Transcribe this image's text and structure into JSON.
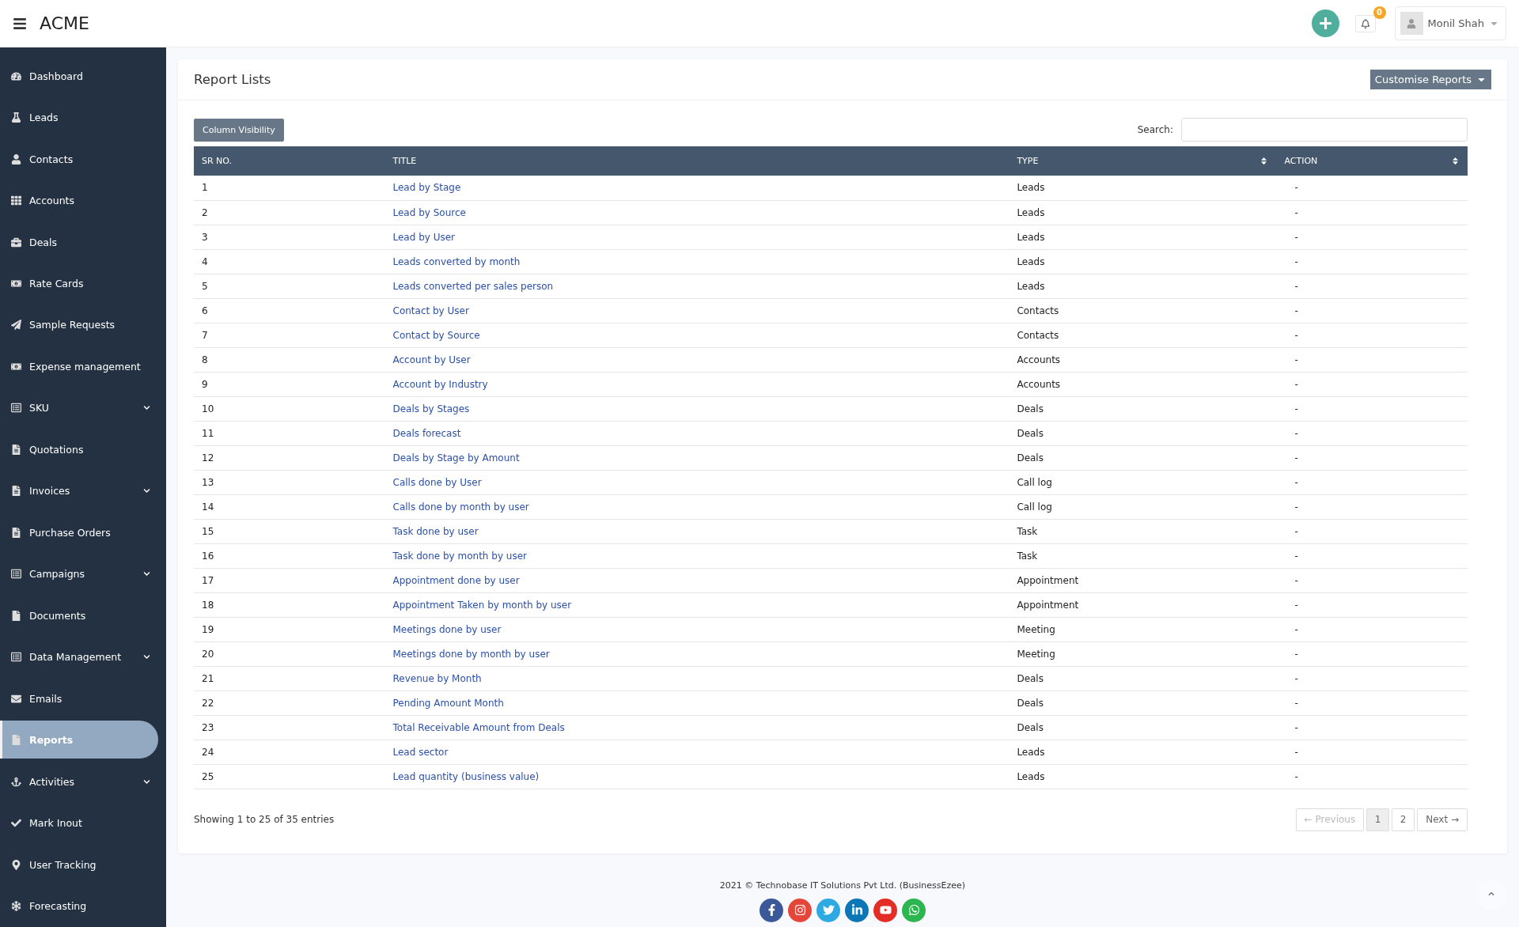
{
  "topbar": {
    "brand": "ACME",
    "notifications": {
      "count": "0"
    },
    "user": {
      "name": "Monil Shah"
    }
  },
  "sidebar": {
    "items": [
      {
        "label": "Dashboard",
        "selected": false,
        "has_submenu": false
      },
      {
        "label": "Leads",
        "selected": false,
        "has_submenu": false
      },
      {
        "label": "Contacts",
        "selected": false,
        "has_submenu": false
      },
      {
        "label": "Accounts",
        "selected": false,
        "has_submenu": false
      },
      {
        "label": "Deals",
        "selected": false,
        "has_submenu": false
      },
      {
        "label": "Rate Cards",
        "selected": false,
        "has_submenu": false
      },
      {
        "label": "Sample Requests",
        "selected": false,
        "has_submenu": false
      },
      {
        "label": "Expense management",
        "selected": false,
        "has_submenu": false
      },
      {
        "label": "SKU",
        "selected": false,
        "has_submenu": true
      },
      {
        "label": "Quotations",
        "selected": false,
        "has_submenu": false
      },
      {
        "label": "Invoices",
        "selected": false,
        "has_submenu": true
      },
      {
        "label": "Purchase Orders",
        "selected": false,
        "has_submenu": false
      },
      {
        "label": "Campaigns",
        "selected": false,
        "has_submenu": true
      },
      {
        "label": "Documents",
        "selected": false,
        "has_submenu": false
      },
      {
        "label": "Data Management",
        "selected": false,
        "has_submenu": true
      },
      {
        "label": "Emails",
        "selected": false,
        "has_submenu": false
      },
      {
        "label": "Reports",
        "selected": true,
        "has_submenu": false
      },
      {
        "label": "Activities",
        "selected": false,
        "has_submenu": true
      },
      {
        "label": "Mark Inout",
        "selected": false,
        "has_submenu": false
      },
      {
        "label": "User Tracking",
        "selected": false,
        "has_submenu": false
      },
      {
        "label": "Forecasting",
        "selected": false,
        "has_submenu": false
      }
    ]
  },
  "card": {
    "title": "Report Lists",
    "menu_button": "Customise Reports",
    "column_visibility_button": "Column Visibility",
    "search": {
      "label": "Search:"
    }
  },
  "table": {
    "columns": [
      {
        "label": "SR NO.",
        "sortable": false
      },
      {
        "label": "TITLE",
        "sortable": false
      },
      {
        "label": "TYPE",
        "sortable": true
      },
      {
        "label": "ACTION",
        "sortable": true
      }
    ],
    "rows": [
      [
        "1",
        "Lead by Stage",
        "Leads",
        "-"
      ],
      [
        "2",
        "Lead by Source",
        "Leads",
        "-"
      ],
      [
        "3",
        "Lead by User",
        "Leads",
        "-"
      ],
      [
        "4",
        "Leads converted by month",
        "Leads",
        "-"
      ],
      [
        "5",
        "Leads converted per sales person",
        "Leads",
        "-"
      ],
      [
        "6",
        "Contact by User",
        "Contacts",
        "-"
      ],
      [
        "7",
        "Contact by Source",
        "Contacts",
        "-"
      ],
      [
        "8",
        "Account by User",
        "Accounts",
        "-"
      ],
      [
        "9",
        "Account by Industry",
        "Accounts",
        "-"
      ],
      [
        "10",
        "Deals by Stages",
        "Deals",
        "-"
      ],
      [
        "11",
        "Deals forecast",
        "Deals",
        "-"
      ],
      [
        "12",
        "Deals by Stage by Amount",
        "Deals",
        "-"
      ],
      [
        "13",
        "Calls done by User",
        "Call log",
        "-"
      ],
      [
        "14",
        "Calls done by month by user",
        "Call log",
        "-"
      ],
      [
        "15",
        "Task done by user",
        "Task",
        "-"
      ],
      [
        "16",
        "Task done by month by user",
        "Task",
        "-"
      ],
      [
        "17",
        "Appointment done by user",
        "Appointment",
        "-"
      ],
      [
        "18",
        "Appointment Taken by month by user",
        "Appointment",
        "-"
      ],
      [
        "19",
        "Meetings done by user",
        "Meeting",
        "-"
      ],
      [
        "20",
        "Meetings done by month by user",
        "Meeting",
        "-"
      ],
      [
        "21",
        "Revenue by Month",
        "Deals",
        "-"
      ],
      [
        "22",
        "Pending Amount Month",
        "Deals",
        "-"
      ],
      [
        "23",
        "Total Receivable Amount from Deals",
        "Deals",
        "-"
      ],
      [
        "24",
        "Lead sector",
        "Leads",
        "-"
      ],
      [
        "25",
        "Lead quantity (business value)",
        "Leads",
        "-"
      ]
    ]
  },
  "info": "Showing 1 to 25 of 35 entries",
  "pagination": [
    {
      "label": "← Previous",
      "kind": "nav",
      "disabled": true,
      "selected": false
    },
    {
      "label": "1",
      "kind": "page",
      "disabled": false,
      "selected": true
    },
    {
      "label": "2",
      "kind": "page",
      "disabled": false,
      "selected": false
    },
    {
      "label": "Next →",
      "kind": "nav",
      "disabled": false,
      "selected": false
    }
  ],
  "footer": {
    "copyright": "2021 © Technobase IT Solutions Pvt Ltd. (BusinessEzee)"
  }
}
